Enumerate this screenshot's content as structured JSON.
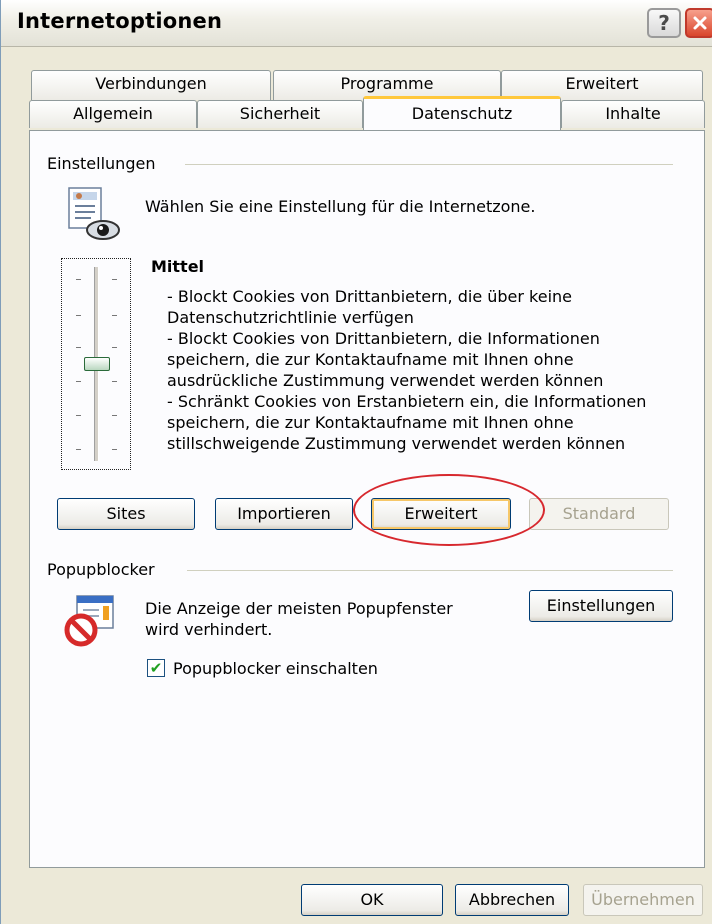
{
  "window": {
    "title": "Internetoptionen"
  },
  "titlebar": {
    "help_glyph": "?",
    "close_icon": "close-icon"
  },
  "tabs": {
    "back": [
      "Verbindungen",
      "Programme",
      "Erweitert"
    ],
    "front": [
      "Allgemein",
      "Sicherheit",
      "Datenschutz",
      "Inhalte"
    ],
    "active": "Datenschutz"
  },
  "settings": {
    "group_label": "Einstellungen",
    "intro": "Wählen Sie eine Einstellung für die Internetzone.",
    "level_title": "Mittel",
    "level_description": [
      "- Blockt Cookies von Drittanbietern, die über keine",
      "Datenschutzrichtlinie verfügen",
      "- Blockt Cookies von Drittanbietern, die Informationen",
      "speichern, die zur Kontaktaufname mit Ihnen ohne",
      "ausdrückliche Zustimmung verwendet werden können",
      "- Schränkt Cookies von Erstanbietern ein, die Informationen",
      "speichern, die zur Kontaktaufname mit Ihnen ohne",
      "stillschweigende Zustimmung verwendet werden können"
    ],
    "slider_level": 0.5,
    "buttons": {
      "sites": "Sites",
      "import": "Importieren",
      "advanced": "Erweitert",
      "default": "Standard"
    }
  },
  "popup": {
    "group_label": "Popupblocker",
    "text_line1": "Die Anzeige der meisten Popupfenster",
    "text_line2": "wird verhindert.",
    "settings_button": "Einstellungen",
    "checkbox_label": "Popupblocker einschalten",
    "checkbox_checked": true
  },
  "footer": {
    "ok": "OK",
    "cancel": "Abbrechen",
    "apply": "Übernehmen"
  },
  "colors": {
    "dialog_bg": "#ece9d8",
    "panel_bg": "#fcfcfe",
    "active_tab_accent": "#ffc83c",
    "highlight_ring": "#d7282e",
    "button_border": "#003c74"
  }
}
